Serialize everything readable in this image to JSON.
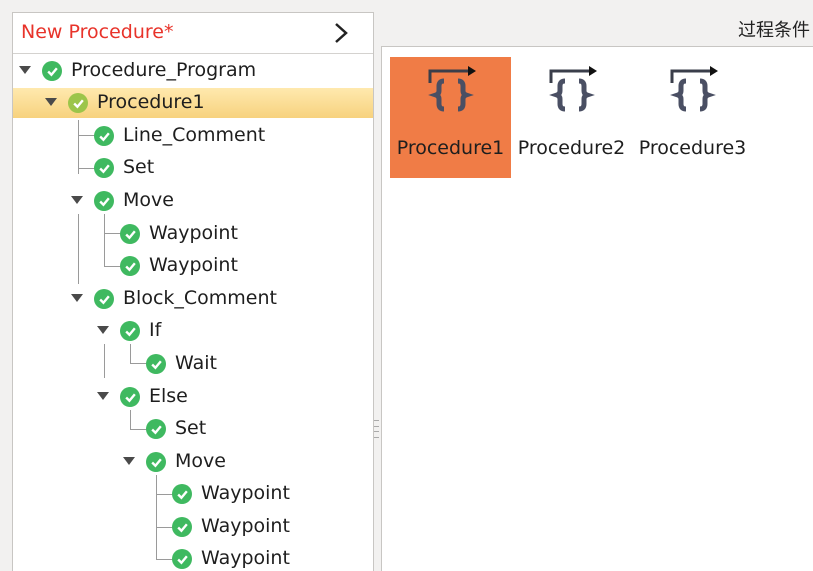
{
  "left_panel": {
    "title": "New Procedure*",
    "collapse_icon": "chevron-right-icon",
    "tree": [
      {
        "label": "Procedure_Program"
      },
      {
        "label": "Procedure1"
      },
      {
        "label": "Line_Comment"
      },
      {
        "label": "Set"
      },
      {
        "label": "Move"
      },
      {
        "label": "Waypoint"
      },
      {
        "label": "Waypoint"
      },
      {
        "label": "Block_Comment"
      },
      {
        "label": "If"
      },
      {
        "label": "Wait"
      },
      {
        "label": "Else"
      },
      {
        "label": "Set"
      },
      {
        "label": "Move"
      },
      {
        "label": "Waypoint"
      },
      {
        "label": "Waypoint"
      },
      {
        "label": "Waypoint"
      }
    ]
  },
  "right_panel": {
    "header_label": "过程条件",
    "procedures": [
      {
        "label": "Procedure1",
        "icon": "procedure-braces-icon"
      },
      {
        "label": "Procedure2",
        "icon": "procedure-braces-icon"
      },
      {
        "label": "Procedure3",
        "icon": "procedure-braces-icon"
      }
    ]
  },
  "colors": {
    "title_red": "#e8332a",
    "selected_tile": "#f07c46",
    "selected_row": "#f7d27e",
    "check_green": "#3fb960"
  }
}
